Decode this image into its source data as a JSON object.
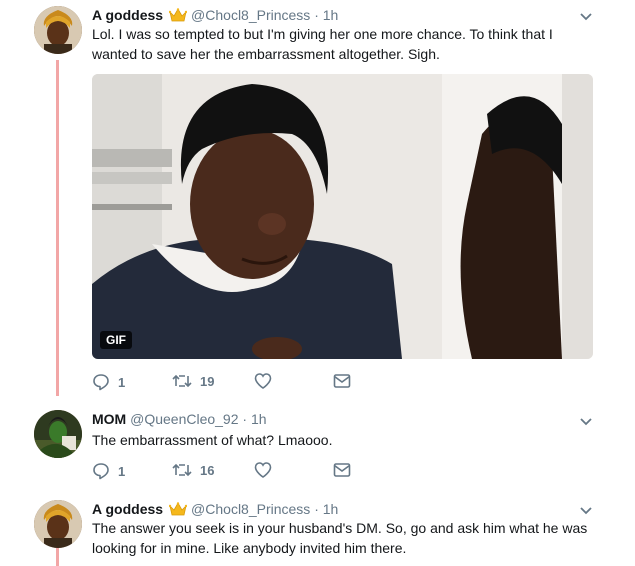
{
  "colors": {
    "thread_line": "#f2a6a6",
    "icon": "#657786",
    "crown": "#f5b81c"
  },
  "tweets": [
    {
      "name": "A goddess",
      "handle": "@Chocl8_Princess",
      "time": "· 1h",
      "text": "Lol. I was so tempted to but I'm giving her one more chance. To think that I wanted to save her the embarrassment altogether. Sigh.",
      "media_badge": "GIF",
      "replies": "1",
      "retweets": "19",
      "badge_icon": "crown-emoji-icon"
    },
    {
      "name": "MOM",
      "handle": "@QueenCleo_92",
      "time": "· 1h",
      "text": "The embarrassment of what? Lmaooo.",
      "replies": "1",
      "retweets": "16"
    },
    {
      "name": "A goddess",
      "handle": "@Chocl8_Princess",
      "time": "· 1h",
      "text": "The answer you seek is in your husband's DM. So, go and ask him what he was looking for in mine. Like anybody invited him there.",
      "badge_icon": "crown-emoji-icon"
    }
  ]
}
